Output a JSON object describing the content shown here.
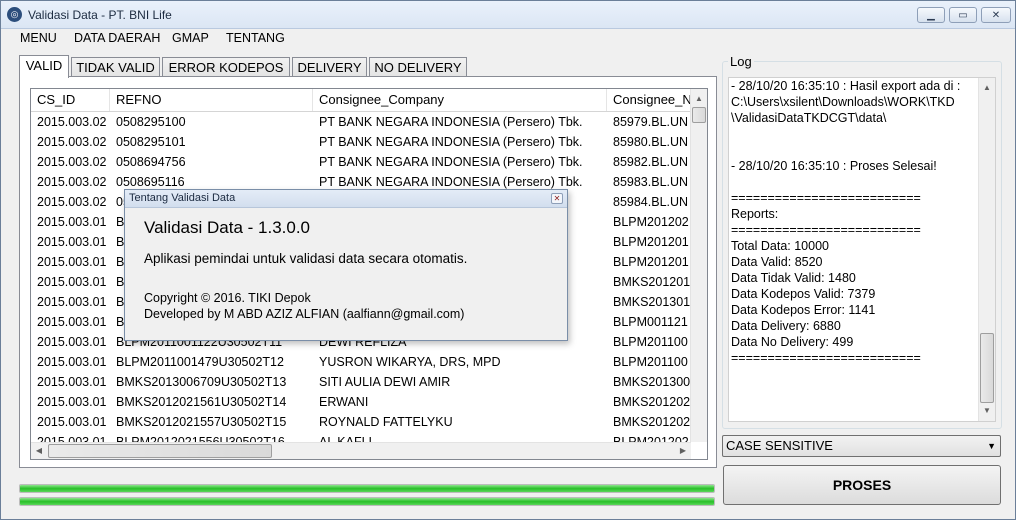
{
  "window": {
    "title": "Validasi Data - PT. BNI Life"
  },
  "menu": [
    "MENU",
    "DATA DAERAH",
    "GMAP",
    "TENTANG"
  ],
  "tabs": [
    {
      "label": "VALID",
      "active": true
    },
    {
      "label": "TIDAK VALID",
      "active": false
    },
    {
      "label": "ERROR KODEPOS",
      "active": false
    },
    {
      "label": "DELIVERY",
      "active": false
    },
    {
      "label": "NO DELIVERY",
      "active": false
    }
  ],
  "grid": {
    "columns": [
      "CS_ID",
      "REFNO",
      "Consignee_Company",
      "Consignee_N"
    ],
    "rows": [
      [
        "2015.003.02",
        "0508295100",
        "PT BANK NEGARA INDONESIA (Persero) Tbk.",
        "85979.BL.UN"
      ],
      [
        "2015.003.02",
        "0508295101",
        "PT BANK NEGARA INDONESIA (Persero) Tbk.",
        "85980.BL.UN"
      ],
      [
        "2015.003.02",
        "0508694756",
        "PT BANK NEGARA INDONESIA (Persero) Tbk.",
        "85982.BL.UN"
      ],
      [
        "2015.003.02",
        "0508695116",
        "PT BANK NEGARA INDONESIA (Persero) Tbk.",
        "85983.BL.UN"
      ],
      [
        "2015.003.02",
        "05",
        "Tbk.",
        "85984.BL.UN"
      ],
      [
        "2015.003.01",
        "B",
        "",
        "BLPM201202"
      ],
      [
        "2015.003.01",
        "B",
        "",
        "BLPM201201"
      ],
      [
        "2015.003.01",
        "B",
        "",
        "BLPM201201"
      ],
      [
        "2015.003.01",
        "B",
        "",
        "BMKS201201"
      ],
      [
        "2015.003.01",
        "B",
        "",
        "BMKS201301"
      ],
      [
        "2015.003.01",
        "B",
        "",
        "BLPM001121"
      ],
      [
        "2015.003.01",
        "BLPM2011001122U30502T11",
        "DEWI REFLIZA",
        "BLPM201100"
      ],
      [
        "2015.003.01",
        "BLPM2011001479U30502T12",
        "YUSRON WIKARYA, DRS, MPD",
        "BLPM201100"
      ],
      [
        "2015.003.01",
        "BMKS2013006709U30502T13",
        "SITI AULIA DEWI AMIR",
        "BMKS201300"
      ],
      [
        "2015.003.01",
        "BMKS2012021561U30502T14",
        "ERWANI",
        "BMKS201202"
      ],
      [
        "2015.003.01",
        "BMKS2012021557U30502T15",
        "ROYNALD FATTELYKU",
        "BMKS201202"
      ],
      [
        "2015.003.01",
        "BLPM2012021556U30502T16",
        "AL KAFLI",
        "BLPM201202"
      ]
    ]
  },
  "log": {
    "label": "Log",
    "lines": [
      "- 28/10/20 16:35:10 : Hasil export ada di :",
      "C:\\Users\\xsilent\\Downloads\\WORK\\TKD",
      "\\ValidasiDataTKDCGT\\data\\",
      "",
      "",
      "- 28/10/20 16:35:10 : Proses Selesai!",
      "",
      "==========================",
      "Reports:",
      "==========================",
      "Total Data: 10000",
      "Data Valid: 8520",
      "Data Tidak Valid: 1480",
      "Data Kodepos Valid: 7379",
      "Data Kodepos Error: 1141",
      "Data Delivery: 6880",
      "Data No Delivery: 499",
      "=========================="
    ]
  },
  "combo": {
    "value": "CASE SENSITIVE"
  },
  "proses_button": "PROSES",
  "progress": [
    1.0,
    1.0
  ],
  "dialog": {
    "title": "Tentang Validasi Data",
    "heading": "Validasi Data - 1.3.0.0",
    "description": "Aplikasi pemindai untuk validasi data secara otomatis.",
    "copyright": "Copyright © 2016. TIKI Depok",
    "developer": "Developed by M ABD AZIZ ALFIAN (aalfiann@gmail.com)"
  },
  "colors": {
    "progress": "#28c028",
    "titlebar": "#dbe6f4"
  },
  "icons": [
    "app-icon",
    "minimize-icon",
    "maximize-icon",
    "close-icon",
    "dropdown-arrow-icon"
  ]
}
